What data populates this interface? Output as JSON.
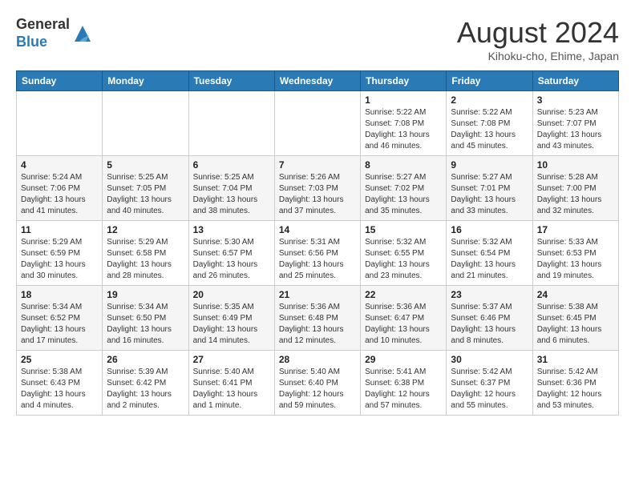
{
  "logo": {
    "line1": "General",
    "line2": "Blue"
  },
  "title": "August 2024",
  "location": "Kihoku-cho, Ehime, Japan",
  "days_of_week": [
    "Sunday",
    "Monday",
    "Tuesday",
    "Wednesday",
    "Thursday",
    "Friday",
    "Saturday"
  ],
  "weeks": [
    [
      {
        "day": "",
        "info": ""
      },
      {
        "day": "",
        "info": ""
      },
      {
        "day": "",
        "info": ""
      },
      {
        "day": "",
        "info": ""
      },
      {
        "day": "1",
        "info": "Sunrise: 5:22 AM\nSunset: 7:08 PM\nDaylight: 13 hours\nand 46 minutes."
      },
      {
        "day": "2",
        "info": "Sunrise: 5:22 AM\nSunset: 7:08 PM\nDaylight: 13 hours\nand 45 minutes."
      },
      {
        "day": "3",
        "info": "Sunrise: 5:23 AM\nSunset: 7:07 PM\nDaylight: 13 hours\nand 43 minutes."
      }
    ],
    [
      {
        "day": "4",
        "info": "Sunrise: 5:24 AM\nSunset: 7:06 PM\nDaylight: 13 hours\nand 41 minutes."
      },
      {
        "day": "5",
        "info": "Sunrise: 5:25 AM\nSunset: 7:05 PM\nDaylight: 13 hours\nand 40 minutes."
      },
      {
        "day": "6",
        "info": "Sunrise: 5:25 AM\nSunset: 7:04 PM\nDaylight: 13 hours\nand 38 minutes."
      },
      {
        "day": "7",
        "info": "Sunrise: 5:26 AM\nSunset: 7:03 PM\nDaylight: 13 hours\nand 37 minutes."
      },
      {
        "day": "8",
        "info": "Sunrise: 5:27 AM\nSunset: 7:02 PM\nDaylight: 13 hours\nand 35 minutes."
      },
      {
        "day": "9",
        "info": "Sunrise: 5:27 AM\nSunset: 7:01 PM\nDaylight: 13 hours\nand 33 minutes."
      },
      {
        "day": "10",
        "info": "Sunrise: 5:28 AM\nSunset: 7:00 PM\nDaylight: 13 hours\nand 32 minutes."
      }
    ],
    [
      {
        "day": "11",
        "info": "Sunrise: 5:29 AM\nSunset: 6:59 PM\nDaylight: 13 hours\nand 30 minutes."
      },
      {
        "day": "12",
        "info": "Sunrise: 5:29 AM\nSunset: 6:58 PM\nDaylight: 13 hours\nand 28 minutes."
      },
      {
        "day": "13",
        "info": "Sunrise: 5:30 AM\nSunset: 6:57 PM\nDaylight: 13 hours\nand 26 minutes."
      },
      {
        "day": "14",
        "info": "Sunrise: 5:31 AM\nSunset: 6:56 PM\nDaylight: 13 hours\nand 25 minutes."
      },
      {
        "day": "15",
        "info": "Sunrise: 5:32 AM\nSunset: 6:55 PM\nDaylight: 13 hours\nand 23 minutes."
      },
      {
        "day": "16",
        "info": "Sunrise: 5:32 AM\nSunset: 6:54 PM\nDaylight: 13 hours\nand 21 minutes."
      },
      {
        "day": "17",
        "info": "Sunrise: 5:33 AM\nSunset: 6:53 PM\nDaylight: 13 hours\nand 19 minutes."
      }
    ],
    [
      {
        "day": "18",
        "info": "Sunrise: 5:34 AM\nSunset: 6:52 PM\nDaylight: 13 hours\nand 17 minutes."
      },
      {
        "day": "19",
        "info": "Sunrise: 5:34 AM\nSunset: 6:50 PM\nDaylight: 13 hours\nand 16 minutes."
      },
      {
        "day": "20",
        "info": "Sunrise: 5:35 AM\nSunset: 6:49 PM\nDaylight: 13 hours\nand 14 minutes."
      },
      {
        "day": "21",
        "info": "Sunrise: 5:36 AM\nSunset: 6:48 PM\nDaylight: 13 hours\nand 12 minutes."
      },
      {
        "day": "22",
        "info": "Sunrise: 5:36 AM\nSunset: 6:47 PM\nDaylight: 13 hours\nand 10 minutes."
      },
      {
        "day": "23",
        "info": "Sunrise: 5:37 AM\nSunset: 6:46 PM\nDaylight: 13 hours\nand 8 minutes."
      },
      {
        "day": "24",
        "info": "Sunrise: 5:38 AM\nSunset: 6:45 PM\nDaylight: 13 hours\nand 6 minutes."
      }
    ],
    [
      {
        "day": "25",
        "info": "Sunrise: 5:38 AM\nSunset: 6:43 PM\nDaylight: 13 hours\nand 4 minutes."
      },
      {
        "day": "26",
        "info": "Sunrise: 5:39 AM\nSunset: 6:42 PM\nDaylight: 13 hours\nand 2 minutes."
      },
      {
        "day": "27",
        "info": "Sunrise: 5:40 AM\nSunset: 6:41 PM\nDaylight: 13 hours\nand 1 minute."
      },
      {
        "day": "28",
        "info": "Sunrise: 5:40 AM\nSunset: 6:40 PM\nDaylight: 12 hours\nand 59 minutes."
      },
      {
        "day": "29",
        "info": "Sunrise: 5:41 AM\nSunset: 6:38 PM\nDaylight: 12 hours\nand 57 minutes."
      },
      {
        "day": "30",
        "info": "Sunrise: 5:42 AM\nSunset: 6:37 PM\nDaylight: 12 hours\nand 55 minutes."
      },
      {
        "day": "31",
        "info": "Sunrise: 5:42 AM\nSunset: 6:36 PM\nDaylight: 12 hours\nand 53 minutes."
      }
    ]
  ]
}
